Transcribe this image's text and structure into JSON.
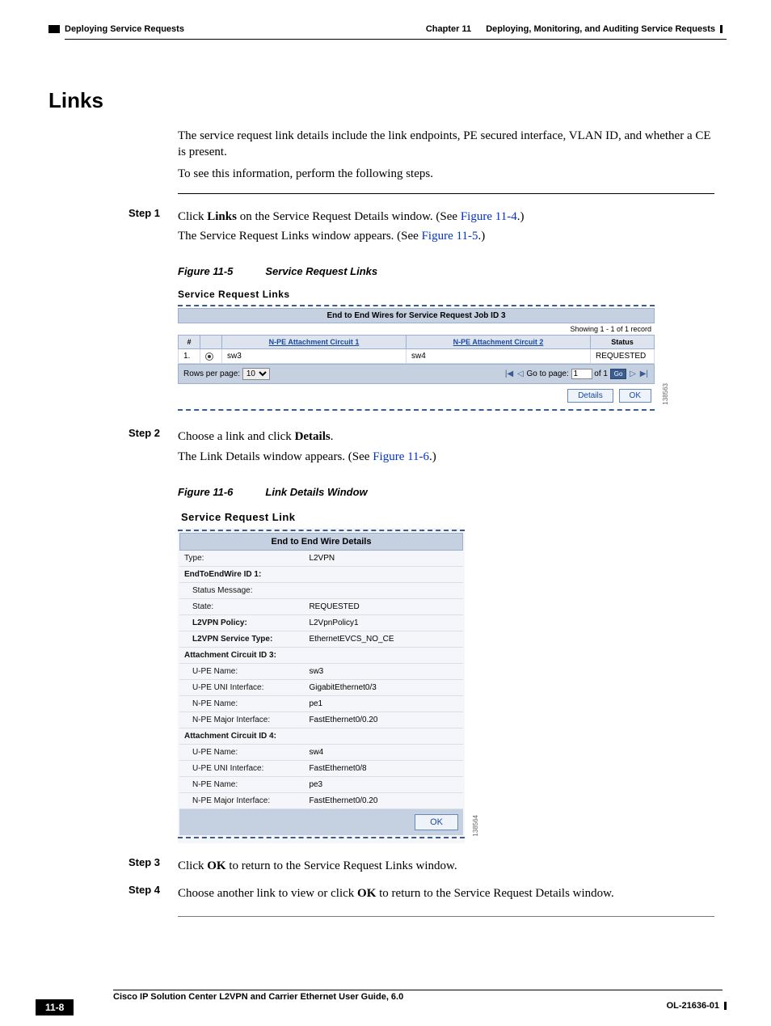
{
  "header": {
    "chapter_label": "Chapter 11",
    "chapter_title": "Deploying, Monitoring, and Auditing Service Requests",
    "section_small": "Deploying Service Requests"
  },
  "section_title": "Links",
  "intro": {
    "p1": "The service request link details include the link endpoints, PE secured interface, VLAN ID, and whether a CE is present.",
    "p2": "To see this information, perform the following steps."
  },
  "step1": {
    "label": "Step 1",
    "line1_pre": "Click ",
    "line1_bold": "Links",
    "line1_mid": " on the Service Request Details window. (See ",
    "line1_link": "Figure 11-4",
    "line1_post": ".)",
    "line2_pre": "The Service Request Links window appears. (See ",
    "line2_link": "Figure 11-5",
    "line2_post": ".)"
  },
  "fig5": {
    "caption_num": "Figure 11-5",
    "caption_title": "Service Request Links",
    "panel_title": "Service Request Links",
    "banner": "End to End Wires for Service Request Job ID 3",
    "showing": "Showing 1 - 1 of 1 record",
    "col_num": "#",
    "col1": "N-PE Attachment Circuit 1",
    "col2": "N-PE Attachment Circuit 2",
    "col_status": "Status",
    "row": {
      "num": "1.",
      "c1": "sw3",
      "c2": "sw4",
      "status": "REQUESTED"
    },
    "rows_per_page_label": "Rows per page:",
    "rows_per_page_value": "10",
    "goto_label": "Go to page:",
    "goto_value": "1",
    "goto_of": "of 1",
    "go_btn": "Go",
    "btn_details": "Details",
    "btn_ok": "OK",
    "sidenum": "138563"
  },
  "step2": {
    "label": "Step 2",
    "line1_pre": "Choose a link and click ",
    "line1_bold": "Details",
    "line1_post": ".",
    "line2_pre": "The Link Details window appears. (See ",
    "line2_link": "Figure 11-6",
    "line2_post": ".)"
  },
  "fig6": {
    "caption_num": "Figure 11-6",
    "caption_title": "Link Details Window",
    "panel_title": "Service Request Link",
    "banner": "End to End Wire Details",
    "rows": {
      "type_k": "Type:",
      "type_v": "L2VPN",
      "etw_k": "EndToEndWire ID 1:",
      "sm_k": "Status Message:",
      "state_k": "State:",
      "state_v": "REQUESTED",
      "pol_k": "L2VPN Policy:",
      "pol_v": "L2VpnPolicy1",
      "svc_k": "L2VPN Service Type:",
      "svc_v": "EthernetEVCS_NO_CE",
      "ac3_k": "Attachment Circuit ID 3:",
      "u3n_k": "U-PE Name:",
      "u3n_v": "sw3",
      "u3i_k": "U-PE UNI Interface:",
      "u3i_v": "GigabitEthernet0/3",
      "n3n_k": "N-PE Name:",
      "n3n_v": "pe1",
      "n3i_k": "N-PE Major Interface:",
      "n3i_v": "FastEthernet0/0.20",
      "ac4_k": "Attachment Circuit ID 4:",
      "u4n_k": "U-PE Name:",
      "u4n_v": "sw4",
      "u4i_k": "U-PE UNI Interface:",
      "u4i_v": "FastEthernet0/8",
      "n4n_k": "N-PE Name:",
      "n4n_v": "pe3",
      "n4i_k": "N-PE Major Interface:",
      "n4i_v": "FastEthernet0/0.20"
    },
    "btn_ok": "OK",
    "sidenum": "138564"
  },
  "step3": {
    "label": "Step 3",
    "pre": "Click ",
    "bold": "OK",
    "post": " to return to the Service Request Links window."
  },
  "step4": {
    "label": "Step 4",
    "pre": "Choose another link to view or click ",
    "bold": "OK",
    "post": " to return to the Service Request Details window."
  },
  "footer": {
    "guide": "Cisco IP Solution Center L2VPN and Carrier Ethernet User Guide, 6.0",
    "page": "11-8",
    "ol": "OL-21636-01"
  }
}
